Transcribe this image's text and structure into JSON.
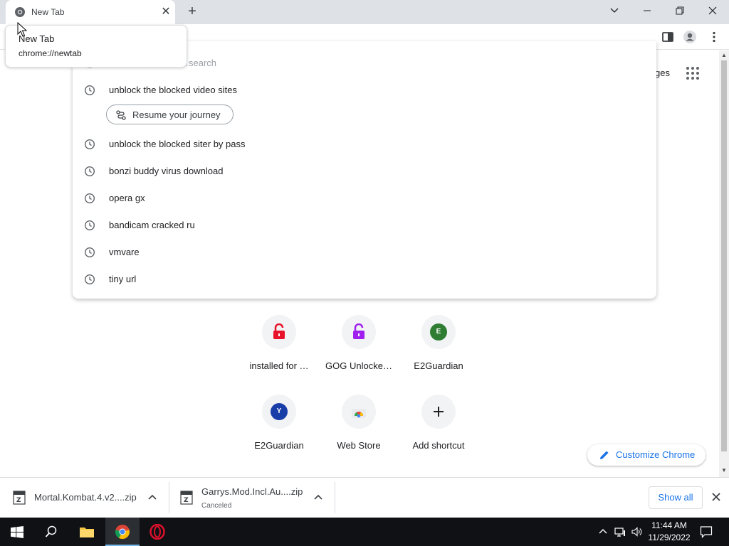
{
  "tab": {
    "title": "New Tab"
  },
  "tooltip": {
    "title": "New Tab",
    "url": "chrome://newtab"
  },
  "omnibox_dropdown": {
    "top_item_partial": "…search",
    "items": [
      {
        "text": "unblock the blocked video sites"
      },
      {
        "text": "unblock the blocked siter by pass"
      },
      {
        "text": "bonzi buddy virus download"
      },
      {
        "text": "opera gx"
      },
      {
        "text": "bandicam cracked ru"
      },
      {
        "text": "vmvare"
      },
      {
        "text": "tiny url"
      }
    ],
    "journey_chip": "Resume your journey"
  },
  "ntp": {
    "apps_partial": "ges",
    "shortcuts": [
      {
        "label": "installed for …",
        "icon": "lock-red-icon",
        "color": "#e8122a"
      },
      {
        "label": "GOG Unlocke…",
        "icon": "lock-purple-icon",
        "color": "#a020f0"
      },
      {
        "label": "E2Guardian",
        "letter": "E",
        "color": "#2e7d32"
      },
      {
        "label": "E2Guardian",
        "letter": "Y",
        "color": "#1a3ea8"
      },
      {
        "label": "Web Store",
        "icon": "webstore-icon"
      },
      {
        "label": "Add shortcut",
        "icon": "plus-icon"
      }
    ],
    "customize": "Customize Chrome"
  },
  "downloads": {
    "items": [
      {
        "name": "Mortal.Kombat.4.v2....zip",
        "status": ""
      },
      {
        "name": "Garrys.Mod.Incl.Au....zip",
        "status": "Canceled"
      }
    ],
    "show_all": "Show all"
  },
  "taskbar": {
    "time": "11:44 AM",
    "date": "11/29/2022"
  }
}
